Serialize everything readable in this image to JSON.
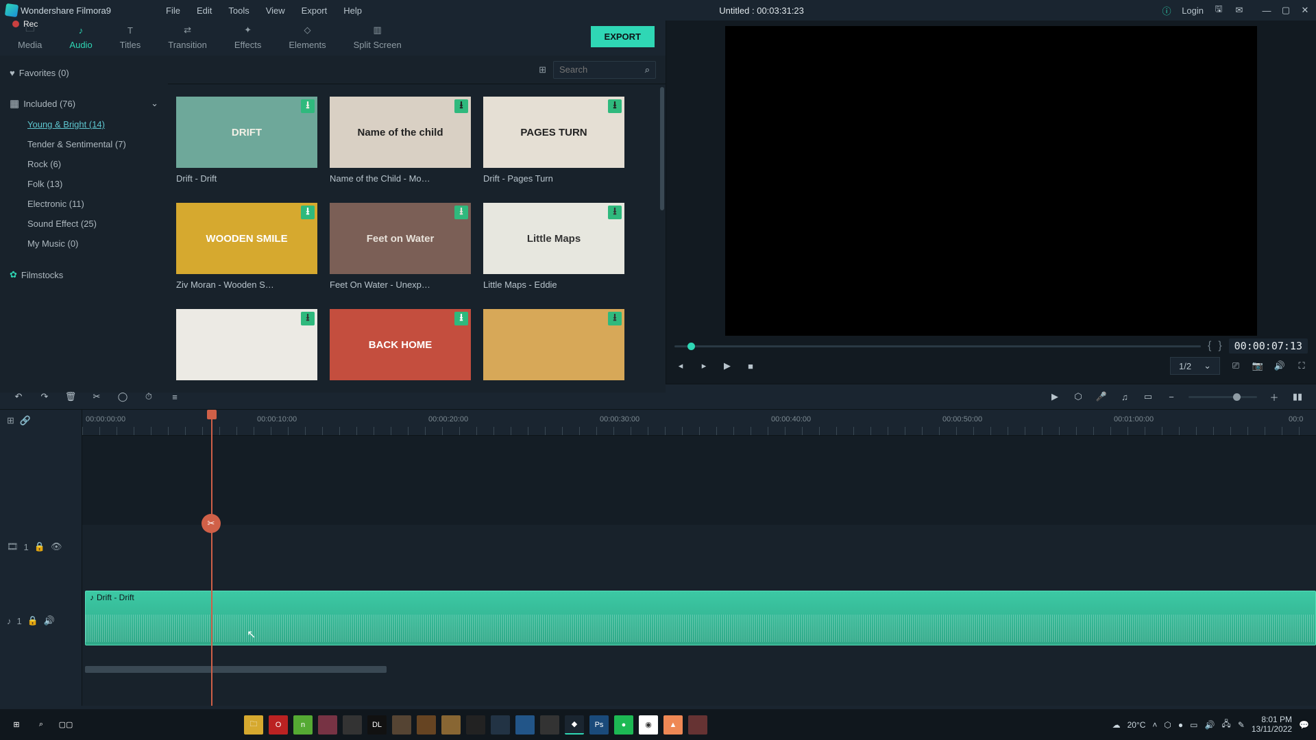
{
  "app": {
    "title": "Wondershare Filmora9",
    "rec_label": "Rec",
    "login": "Login"
  },
  "menubar": [
    "File",
    "Edit",
    "Tools",
    "View",
    "Export",
    "Help"
  ],
  "project_title": "Untitled : 00:03:31:23",
  "module_tabs": [
    {
      "label": "Media"
    },
    {
      "label": "Audio"
    },
    {
      "label": "Titles"
    },
    {
      "label": "Transition"
    },
    {
      "label": "Effects"
    },
    {
      "label": "Elements"
    },
    {
      "label": "Split Screen"
    }
  ],
  "export_label": "EXPORT",
  "sidebar": {
    "favorites": "Favorites (0)",
    "included": "Included (76)",
    "categories": [
      "Young & Bright (14)",
      "Tender & Sentimental (7)",
      "Rock (6)",
      "Folk (13)",
      "Electronic (11)",
      "Sound Effect (25)",
      "My Music (0)"
    ],
    "filmstocks": "Filmstocks"
  },
  "search": {
    "placeholder": "Search"
  },
  "cards": [
    {
      "label": "Drift - Drift",
      "thumb_text": "DRIFT",
      "bg": "#6ea89a",
      "fg": "#f3f0e6"
    },
    {
      "label": "Name of the Child - Mo…",
      "thumb_text": "Name of the child",
      "bg": "#d9d0c4",
      "fg": "#222"
    },
    {
      "label": "Drift - Pages Turn",
      "thumb_text": "PAGES TURN",
      "bg": "#e5dfd4",
      "fg": "#222"
    },
    {
      "label": "Ziv Moran - Wooden S…",
      "thumb_text": "WOODEN SMILE",
      "bg": "#d6a92f",
      "fg": "#fff"
    },
    {
      "label": "Feet On Water - Unexp…",
      "thumb_text": "Feet on Water",
      "bg": "#7b5f56",
      "fg": "#e8e2da"
    },
    {
      "label": "Little Maps - Eddie",
      "thumb_text": "Little Maps",
      "bg": "#e7e7df",
      "fg": "#333"
    },
    {
      "label": "",
      "thumb_text": "",
      "bg": "#eceae4",
      "fg": "#333"
    },
    {
      "label": "",
      "thumb_text": "BACK HOME",
      "bg": "#c44e3e",
      "fg": "#fff"
    },
    {
      "label": "",
      "thumb_text": "",
      "bg": "#d7a858",
      "fg": "#333"
    }
  ],
  "preview": {
    "timecode": "00:00:07:13",
    "quality": "1/2"
  },
  "ruler_labels": [
    "00:00:00:00",
    "00:00:10:00",
    "00:00:20:00",
    "00:00:30:00",
    "00:00:40:00",
    "00:00:50:00",
    "00:01:00:00",
    "00:0"
  ],
  "clip": {
    "label": "Drift - Drift"
  },
  "track_video": "1",
  "track_audio": "1",
  "system": {
    "temp": "20°C",
    "time": "8:01 PM",
    "date": "13/11/2022"
  }
}
